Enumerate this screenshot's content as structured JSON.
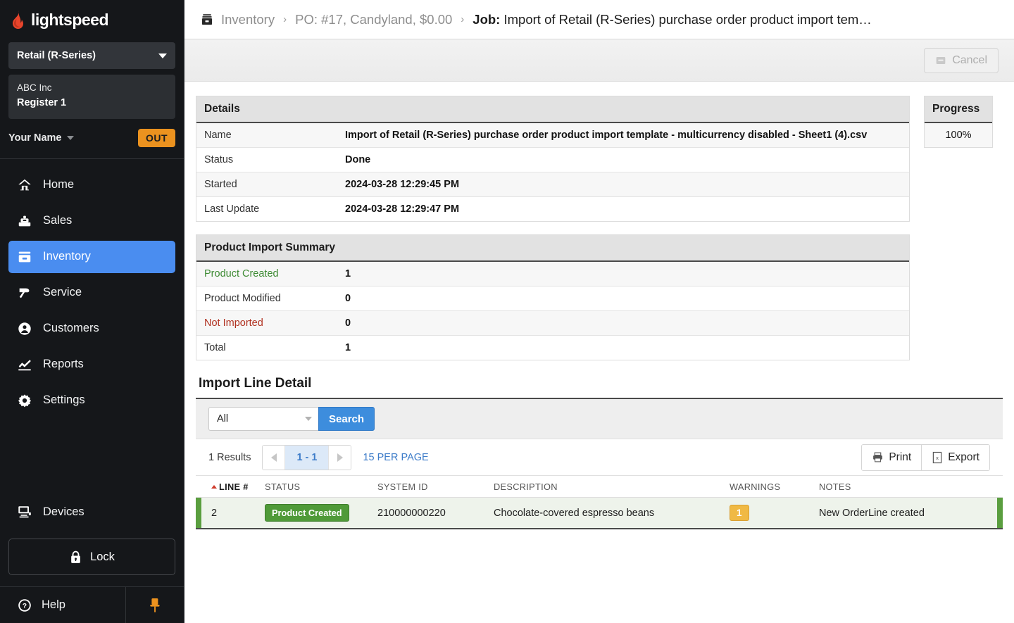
{
  "sidebar": {
    "brand": "lightspeed",
    "store_selector": {
      "label": "Retail (R-Series)",
      "icon": "chevron-down-icon"
    },
    "register": {
      "company": "ABC Inc",
      "register": "Register 1"
    },
    "user": {
      "name": "Your Name",
      "logout_label": "OUT"
    },
    "items": [
      {
        "label": "Home",
        "icon": "home-icon",
        "active": false
      },
      {
        "label": "Sales",
        "icon": "register-icon",
        "active": false
      },
      {
        "label": "Inventory",
        "icon": "inventory-box-icon",
        "active": true
      },
      {
        "label": "Service",
        "icon": "hammer-icon",
        "active": false
      },
      {
        "label": "Customers",
        "icon": "person-icon",
        "active": false
      },
      {
        "label": "Reports",
        "icon": "chart-line-icon",
        "active": false
      },
      {
        "label": "Settings",
        "icon": "gear-icon",
        "active": false
      }
    ],
    "devices": {
      "label": "Devices",
      "icon": "monitor-icon"
    },
    "lock": {
      "label": "Lock",
      "icon": "lock-icon"
    },
    "help": {
      "label": "Help",
      "icon": "question-circle-icon"
    },
    "pin": {
      "icon": "pushpin-icon"
    }
  },
  "breadcrumb": {
    "icon": "inventory-box-icon",
    "items": [
      {
        "label": "Inventory",
        "current": false
      },
      {
        "label": "PO: #17, Candyland, $0.00",
        "current": false
      }
    ],
    "separator": "›",
    "current_prefix": "Job:",
    "current_label": "Import of Retail (R-Series) purchase order product import tem…"
  },
  "toolbar": {
    "cancel_label": "Cancel",
    "cancel_icon": "cancel-box-icon",
    "cancel_disabled": true
  },
  "details": {
    "title": "Details",
    "rows": [
      {
        "key": "Name",
        "value": "Import of Retail (R-Series) purchase order product import template - multicurrency disabled - Sheet1 (4).csv"
      },
      {
        "key": "Status",
        "value": "Done"
      },
      {
        "key": "Started",
        "value": "2024-03-28 12:29:45 PM"
      },
      {
        "key": "Last Update",
        "value": "2024-03-28 12:29:47 PM"
      }
    ]
  },
  "progress": {
    "title": "Progress",
    "value": "100%"
  },
  "summary": {
    "title": "Product Import Summary",
    "rows": [
      {
        "key": "Product Created",
        "value": "1",
        "color": "#3e8b34"
      },
      {
        "key": "Product Modified",
        "value": "0",
        "color": "#333333"
      },
      {
        "key": "Not Imported",
        "value": "0",
        "color": "#b0301f"
      },
      {
        "key": "Total",
        "value": "1",
        "color": "#333333"
      }
    ]
  },
  "line_detail": {
    "title": "Import Line Detail",
    "filter": {
      "selected": "All",
      "icon": "chevron-down-icon"
    },
    "search_button": "Search",
    "results_label": "1 Results",
    "pager": {
      "prev_icon": "chevron-left-icon",
      "range": "1 - 1",
      "next_icon": "chevron-right-icon"
    },
    "per_page": "15 PER PAGE",
    "print": {
      "label": "Print",
      "icon": "printer-icon"
    },
    "export": {
      "label": "Export",
      "icon": "excel-file-icon"
    },
    "columns": [
      "LINE #",
      "STATUS",
      "SYSTEM ID",
      "DESCRIPTION",
      "WARNINGS",
      "NOTES"
    ],
    "sort_column": "LINE #",
    "sort_icon": "caret-up-icon",
    "rows": [
      {
        "line": "2",
        "status": "Product Created",
        "system_id": "210000000220",
        "description": "Chocolate-covered espresso beans",
        "warnings": "1",
        "notes": "New OrderLine created"
      }
    ]
  },
  "colors": {
    "accent_blue": "#4a8df0",
    "brand_red": "#e8452c",
    "out_orange": "#eb921f",
    "status_green": "#4f9a38",
    "warning_amber": "#f0b944",
    "row_green_bg": "#eef3eb",
    "row_edge_green": "#5a9e3f"
  }
}
